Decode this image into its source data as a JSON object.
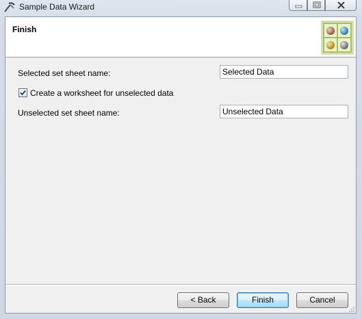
{
  "window": {
    "title": "Sample Data Wizard",
    "app_icon": "wizard-app-icon"
  },
  "header": {
    "title": "Finish",
    "logo_icon": "spheres-grid-logo-icon"
  },
  "form": {
    "selected_label": "Selected set sheet name:",
    "selected_value": "Selected Data",
    "checkbox_label": "Create a worksheet for unselected data",
    "checkbox_checked": true,
    "unselected_label": "Unselected set sheet name:",
    "unselected_value": "Unselected Data"
  },
  "buttons": {
    "back": "< Back",
    "finish": "Finish",
    "cancel": "Cancel"
  },
  "colors": {
    "default_button_border": "#3c7fb1",
    "checkmark": "#1e3f6a"
  }
}
